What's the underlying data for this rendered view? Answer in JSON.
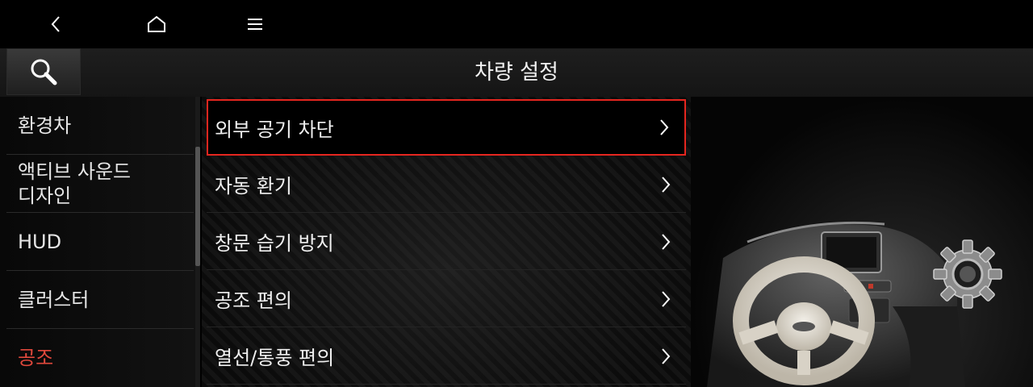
{
  "topbar": {
    "back_icon": "chevron-left-icon",
    "home_icon": "home-icon",
    "menu_icon": "menu-icon"
  },
  "header": {
    "title": "차량 설정",
    "search_icon": "search-icon"
  },
  "sidebar": {
    "items": [
      {
        "label": "환경차"
      },
      {
        "label": "액티브 사운드",
        "label2": "디자인"
      },
      {
        "label": "HUD"
      },
      {
        "label": "클러스터"
      },
      {
        "label": "공조",
        "active": true
      }
    ]
  },
  "list": {
    "items": [
      {
        "label": "외부 공기 차단",
        "selected": true
      },
      {
        "label": "자동 환기"
      },
      {
        "label": "창문 습기 방지"
      },
      {
        "label": "공조 편의"
      },
      {
        "label": "열선/통풍 편의"
      }
    ]
  },
  "colors": {
    "accent_red": "#e0483c",
    "highlight_border": "#e5261f"
  },
  "illustration": {
    "icons": [
      "car-interior-image",
      "gear-icon"
    ]
  }
}
